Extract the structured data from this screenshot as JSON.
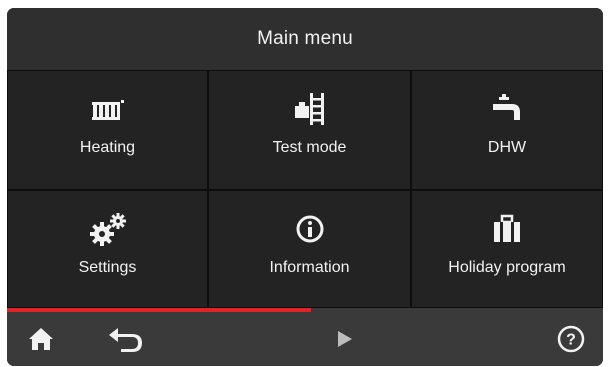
{
  "header": {
    "title": "Main menu"
  },
  "tiles": [
    {
      "label": "Heating",
      "icon": "radiator-icon"
    },
    {
      "label": "Test mode",
      "icon": "test-mode-icon"
    },
    {
      "label": "DHW",
      "icon": "faucet-icon"
    },
    {
      "label": "Settings",
      "icon": "gears-icon"
    },
    {
      "label": "Information",
      "icon": "info-icon"
    },
    {
      "label": "Holiday program",
      "icon": "suitcase-icon"
    }
  ],
  "progress": {
    "fraction": 0.51,
    "color": "#e0242a"
  },
  "footer": {
    "home": "home-icon",
    "back": "back-arrow-icon",
    "next": "play-next-icon",
    "help": "help-icon"
  },
  "colors": {
    "background": "#262626",
    "tile": "#232323",
    "footer": "#3a3a3a",
    "text": "#f2f2f2"
  }
}
